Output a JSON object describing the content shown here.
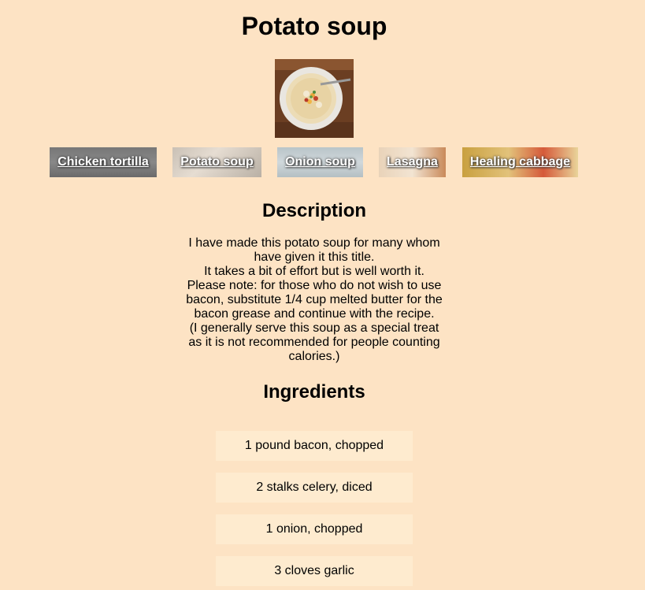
{
  "title": "Potato soup",
  "hero_image": "potato-soup-bowl",
  "nav": [
    {
      "label": "Chicken tortilla"
    },
    {
      "label": "Potato soup"
    },
    {
      "label": "Onion soup"
    },
    {
      "label": "Lasagna"
    },
    {
      "label": "Healing cabbage"
    }
  ],
  "description": {
    "heading": "Description",
    "lines": [
      "I have made this potato soup for many whom have given it this title.",
      "It takes a bit of effort but is well worth it.",
      "Please note: for those who do not wish to use bacon, substitute 1/4 cup melted butter for the bacon grease and continue with the recipe.",
      "(I generally serve this soup as a special treat as it is not recommended for people counting calories.)"
    ]
  },
  "ingredients": {
    "heading": "Ingredients",
    "items": [
      "1 pound bacon, chopped",
      "2 stalks celery, diced",
      "1 onion, chopped",
      "3 cloves garlic"
    ]
  }
}
